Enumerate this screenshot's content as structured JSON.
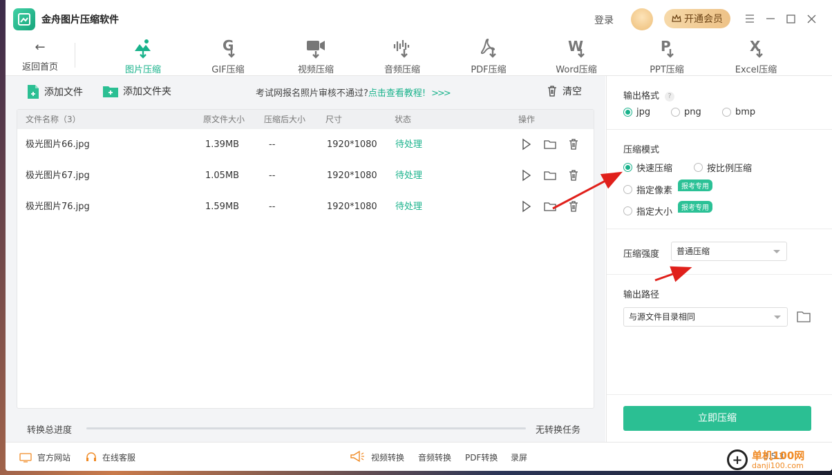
{
  "app": {
    "title": "金舟图片压缩软件"
  },
  "titlebar": {
    "login": "登录",
    "vip": "开通会员"
  },
  "nav": {
    "back": "返回首页",
    "tools": [
      {
        "label": "图片压缩",
        "icon": "image-compress-icon",
        "active": true
      },
      {
        "label": "GIF压缩",
        "icon": "gif-compress-icon"
      },
      {
        "label": "视频压缩",
        "icon": "video-compress-icon"
      },
      {
        "label": "音频压缩",
        "icon": "audio-compress-icon"
      },
      {
        "label": "PDF压缩",
        "icon": "pdf-compress-icon"
      },
      {
        "label": "Word压缩",
        "icon": "word-compress-icon"
      },
      {
        "label": "PPT压缩",
        "icon": "ppt-compress-icon"
      },
      {
        "label": "Excel压缩",
        "icon": "excel-compress-icon"
      }
    ]
  },
  "toolbar": {
    "add_file": "添加文件",
    "add_folder": "添加文件夹",
    "tip_text": "考试网报名照片审核不通过?",
    "tip_link": "点击查看教程!",
    "tip_chevrons": ">>>",
    "clear": "清空"
  },
  "table": {
    "headers": {
      "name": "文件名称（3）",
      "orig_size": "原文件大小",
      "comp_size": "压缩后大小",
      "dims": "尺寸",
      "status": "状态",
      "ops": "操作"
    },
    "rows": [
      {
        "name": "极光图片66.jpg",
        "orig_size": "1.39MB",
        "comp_size": "--",
        "dims": "1920*1080",
        "status": "待处理"
      },
      {
        "name": "极光图片67.jpg",
        "orig_size": "1.05MB",
        "comp_size": "--",
        "dims": "1920*1080",
        "status": "待处理"
      },
      {
        "name": "极光图片76.jpg",
        "orig_size": "1.59MB",
        "comp_size": "--",
        "dims": "1920*1080",
        "status": "待处理"
      }
    ]
  },
  "progress": {
    "label": "转换总进度",
    "value": 0,
    "status": "无转换任务"
  },
  "settings": {
    "output_format": {
      "title": "输出格式",
      "help": "?",
      "options": [
        "jpg",
        "png",
        "bmp"
      ],
      "selected": "jpg"
    },
    "compress_mode": {
      "title": "压缩模式",
      "options": [
        "快速压缩",
        "按比例压缩",
        "指定像素",
        "指定大小"
      ],
      "selected": "快速压缩",
      "badge": "报考专用"
    },
    "strength": {
      "title": "压缩强度",
      "value": "普通压缩"
    },
    "output_path": {
      "title": "输出路径",
      "value": "与源文件目录相同"
    },
    "compress_button": "立即压缩"
  },
  "footer": {
    "website": "官方网站",
    "support": "在线客服",
    "links": [
      "视频转换",
      "音频转换",
      "PDF转换",
      "录屏"
    ],
    "version": "3.5.3"
  },
  "watermark": {
    "text": "单机100网",
    "sub": "danji100.com"
  },
  "colors": {
    "accent": "#19b28b",
    "button": "#2bbf93",
    "annotation": "#e0201b"
  }
}
